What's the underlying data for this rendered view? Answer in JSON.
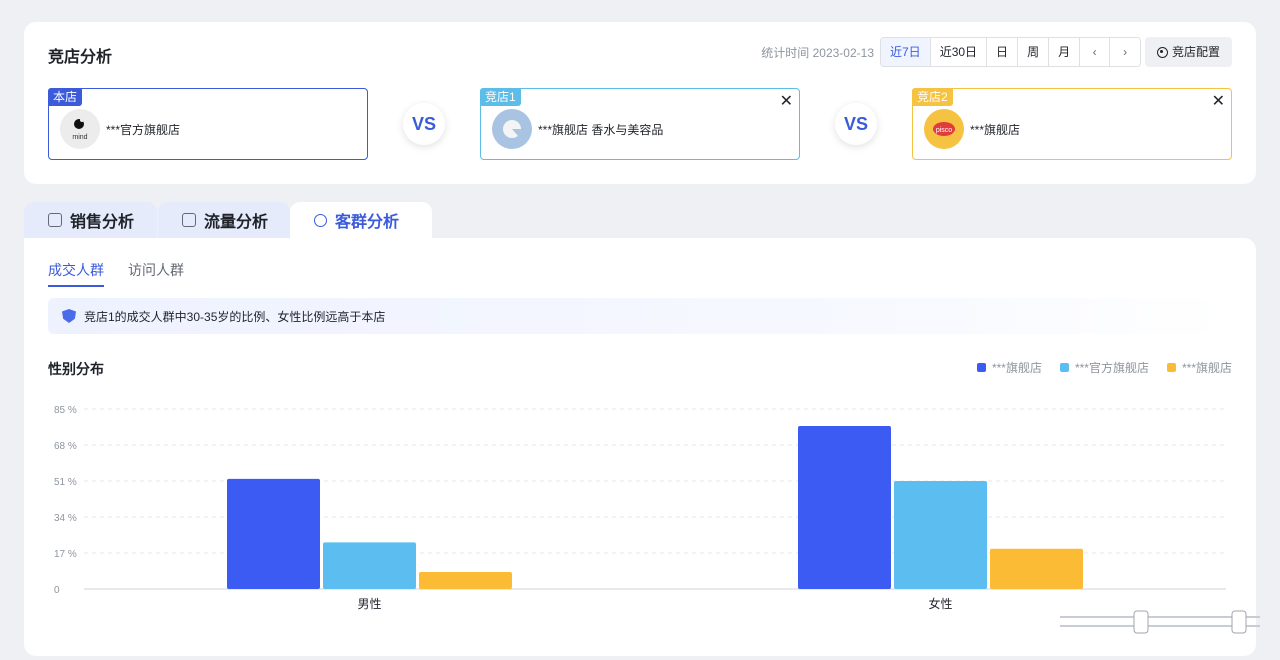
{
  "header": {
    "title": "竞店分析",
    "stat_label": "统计时间 2023-02-13",
    "ranges": [
      "近7日",
      "近30日",
      "日",
      "周",
      "月"
    ],
    "active_range": "近7日",
    "config_label": "竞店配置"
  },
  "stores": {
    "own": {
      "tag": "本店",
      "name": "***官方旗舰店",
      "logo_text": "mind"
    },
    "c1": {
      "tag": "竞店1",
      "name": "***旗舰店 香水与美容品"
    },
    "c2": {
      "tag": "竞店2",
      "name": "***旗舰店",
      "logo_text": "pisco"
    }
  },
  "vs_label": "VS",
  "tabs": [
    "销售分析",
    "流量分析",
    "客群分析"
  ],
  "subtabs": [
    "成交人群",
    "访问人群"
  ],
  "notice": "竞店1的成交人群中30-35岁的比例、女性比例远高于本店",
  "colors": {
    "blue": "#3b5bf3",
    "light_blue": "#5bbdf0",
    "yellow": "#fbbb34",
    "accent": "#3b5bdb"
  },
  "chart_data": {
    "type": "bar",
    "title": "性别分布",
    "categories": [
      "男性",
      "女性"
    ],
    "series": [
      {
        "name": "***旗舰店",
        "color": "#3b5bf3",
        "values": [
          52,
          77
        ]
      },
      {
        "name": "***官方旗舰店",
        "color": "#5bbdf0",
        "values": [
          22,
          51
        ]
      },
      {
        "name": "***旗舰店",
        "color": "#fbbb34",
        "values": [
          8,
          19
        ]
      }
    ],
    "yticks": [
      "0",
      "17 %",
      "34 %",
      "51 %",
      "68 %",
      "85 %"
    ],
    "ylim": [
      0,
      85
    ],
    "grid": true,
    "legend_position": "top-right"
  }
}
